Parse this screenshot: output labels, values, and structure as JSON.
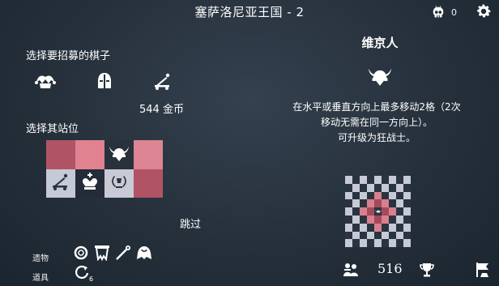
{
  "header": {
    "title": "塞萨洛尼亚王国 - 2",
    "kills_count": "0"
  },
  "recruit": {
    "heading": "选择要招募的棋子",
    "gold_text": "544 金币",
    "pieces": [
      "jester-icon",
      "knight-helmet-icon",
      "catapult-icon"
    ]
  },
  "placement": {
    "heading": "选择其站位",
    "rows": [
      [
        {
          "color": "#b05465",
          "piece": ""
        },
        {
          "color": "#e0828f",
          "piece": ""
        },
        {
          "color": "#28313c",
          "piece": "viking-helmet-icon"
        },
        {
          "color": "#dd8592",
          "piece": ""
        }
      ],
      [
        {
          "color": "#c6c9d6",
          "piece": "catapult-icon"
        },
        {
          "color": "#232c38",
          "piece": "king-icon"
        },
        {
          "color": "#c9cad6",
          "piece": "laurel-icon"
        },
        {
          "color": "#b05465",
          "piece": ""
        }
      ]
    ]
  },
  "skip_label": "跳过",
  "bottom_left": {
    "relics_label": "遗物",
    "items_label": "道具",
    "relic_icons": [
      "ring-icon",
      "banner-icon",
      "staff-icon",
      "cloak-icon"
    ],
    "item_icons": [
      "refresh-icon"
    ],
    "item_count": "6"
  },
  "info": {
    "piece_name": "维京人",
    "icon": "viking-helmet-icon",
    "description_lines": [
      "在水平或垂直方向上最多移动2格（2次",
      "移动无需在同一方向上）。",
      "可升级为狂战士。"
    ],
    "move_board": {
      "light": "#c6c9d6",
      "dark": "#2a3440",
      "highlight_light": "#d8808e",
      "highlight_dark": "#a44a5b"
    }
  },
  "bottom_right": {
    "gold_value": "516",
    "icons": [
      "army-icon",
      "trophy-icon",
      "flag-icon"
    ]
  },
  "colors": {
    "background": "#25303b",
    "text": "#ffffff"
  }
}
